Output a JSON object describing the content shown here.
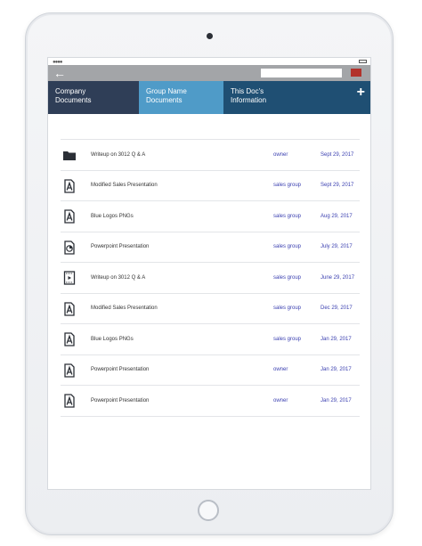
{
  "device": {
    "camera": "camera",
    "home": "home-button"
  },
  "statusbar": {
    "indicator_dots": "●●●●"
  },
  "topbar": {
    "back_icon": "←",
    "search_placeholder": "",
    "accent": "#b2322b"
  },
  "tabs": [
    {
      "line1": "Company",
      "line2": "Documents",
      "color": "#2f3e57"
    },
    {
      "line1": "Group Name",
      "line2": "Documents",
      "color": "#4f9bc8"
    },
    {
      "line1": "This Doc's",
      "line2": "Information",
      "color": "#1f4f73"
    }
  ],
  "add_label": "+",
  "documents": [
    {
      "icon": "folder-icon",
      "name": "Writeup on 3012 Q & A",
      "owner": "owner",
      "date": "Sept 29, 2017"
    },
    {
      "icon": "document-a-icon",
      "name": "Modified Sales Presentation",
      "owner": "sales group",
      "date": "Sept 29, 2017"
    },
    {
      "icon": "document-a-icon",
      "name": "Blue Logos PNGs",
      "owner": "sales group",
      "date": "Aug 29, 2017"
    },
    {
      "icon": "chart-document-icon",
      "name": "Powerpoint Presentation",
      "owner": "sales group",
      "date": "July 29, 2017"
    },
    {
      "icon": "video-document-icon",
      "name": "Writeup on 3012 Q & A",
      "owner": "sales group",
      "date": "June 29, 2017"
    },
    {
      "icon": "document-a-icon",
      "name": "Modified Sales Presentation",
      "owner": "sales group",
      "date": "Dec 29, 2017"
    },
    {
      "icon": "document-a-icon",
      "name": "Blue Logos PNGs",
      "owner": "sales group",
      "date": "Jan 29, 2017"
    },
    {
      "icon": "document-a-icon",
      "name": "Powerpoint Presentation",
      "owner": "owner",
      "date": "Jan 29, 2017"
    },
    {
      "icon": "document-a-icon",
      "name": "Powerpoint Presentation",
      "owner": "owner",
      "date": "Jan 29, 2017"
    }
  ]
}
